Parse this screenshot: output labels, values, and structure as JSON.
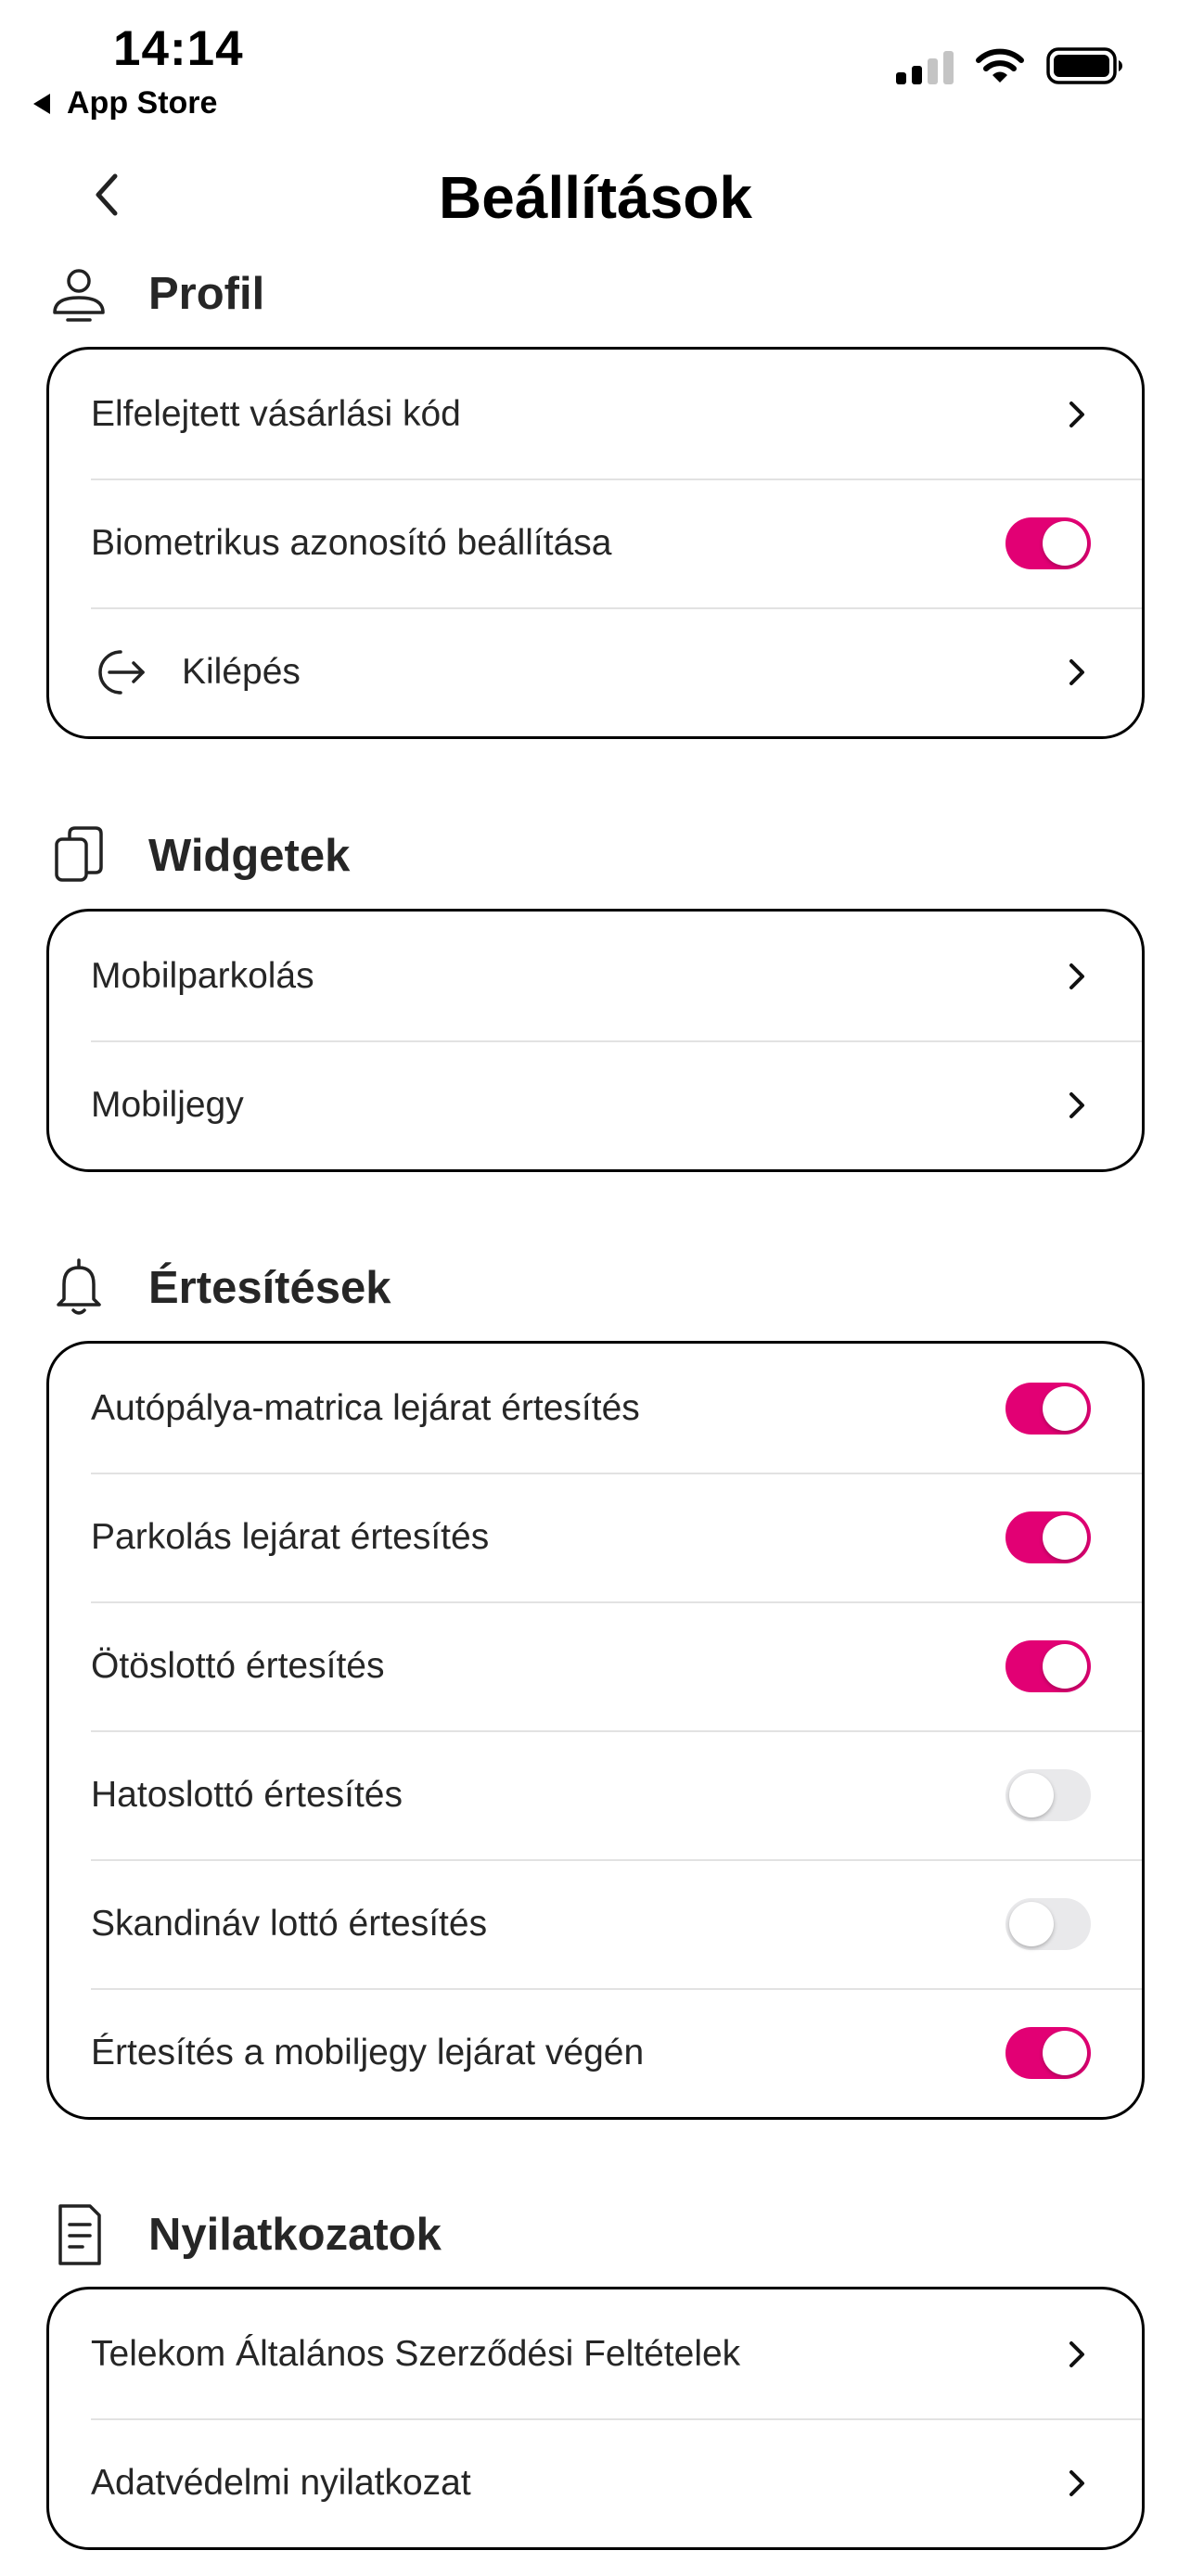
{
  "status_bar": {
    "time": "14:14",
    "back_app": "App Store"
  },
  "nav": {
    "title": "Beállítások"
  },
  "sections": {
    "profile": {
      "title": "Profil",
      "rows": [
        {
          "label": "Elfelejtett vásárlási kód",
          "type": "chevron"
        },
        {
          "label": "Biometrikus azonosító beállítása",
          "type": "toggle",
          "on": true
        },
        {
          "label": "Kilépés",
          "type": "chevron",
          "icon": "logout-icon"
        }
      ]
    },
    "widgets": {
      "title": "Widgetek",
      "rows": [
        {
          "label": "Mobilparkolás",
          "type": "chevron"
        },
        {
          "label": "Mobiljegy",
          "type": "chevron"
        }
      ]
    },
    "notifications": {
      "title": "Értesítések",
      "rows": [
        {
          "label": "Autópálya-matrica lejárat értesítés",
          "type": "toggle",
          "on": true
        },
        {
          "label": "Parkolás lejárat értesítés",
          "type": "toggle",
          "on": true
        },
        {
          "label": "Ötöslottó értesítés",
          "type": "toggle",
          "on": true
        },
        {
          "label": "Hatoslottó értesítés",
          "type": "toggle",
          "on": false
        },
        {
          "label": "Skandináv lottó értesítés",
          "type": "toggle",
          "on": false
        },
        {
          "label": "Értesítés a mobiljegy lejárat végén",
          "type": "toggle",
          "on": true
        }
      ]
    },
    "statements": {
      "title": "Nyilatkozatok",
      "rows": [
        {
          "label": "Telekom Általános Szerződési Feltételek",
          "type": "chevron"
        },
        {
          "label": "Adatvédelmi nyilatkozat",
          "type": "chevron"
        }
      ]
    }
  },
  "colors": {
    "accent": "#e20074",
    "toggle_off": "#e9e9eb"
  }
}
